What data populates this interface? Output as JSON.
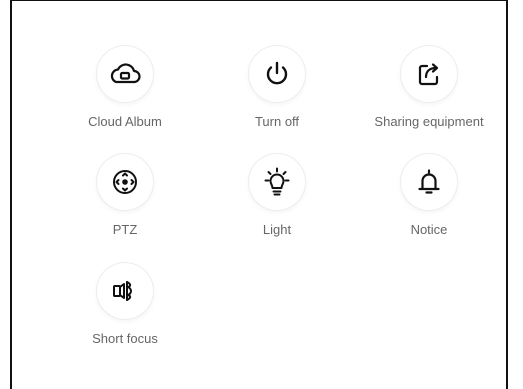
{
  "actions": [
    {
      "label": "Cloud Album",
      "icon": "cloud-album-icon"
    },
    {
      "label": "Turn off",
      "icon": "power-icon"
    },
    {
      "label": "Sharing equipment",
      "icon": "share-icon"
    },
    {
      "label": "PTZ",
      "icon": "ptz-joystick-icon"
    },
    {
      "label": "Light",
      "icon": "light-bulb-icon"
    },
    {
      "label": "Notice",
      "icon": "bell-icon"
    },
    {
      "label": "Short focus",
      "icon": "short-focus-icon"
    }
  ],
  "colors": {
    "icon": "#111111",
    "label": "#666666",
    "border": "#111111"
  }
}
